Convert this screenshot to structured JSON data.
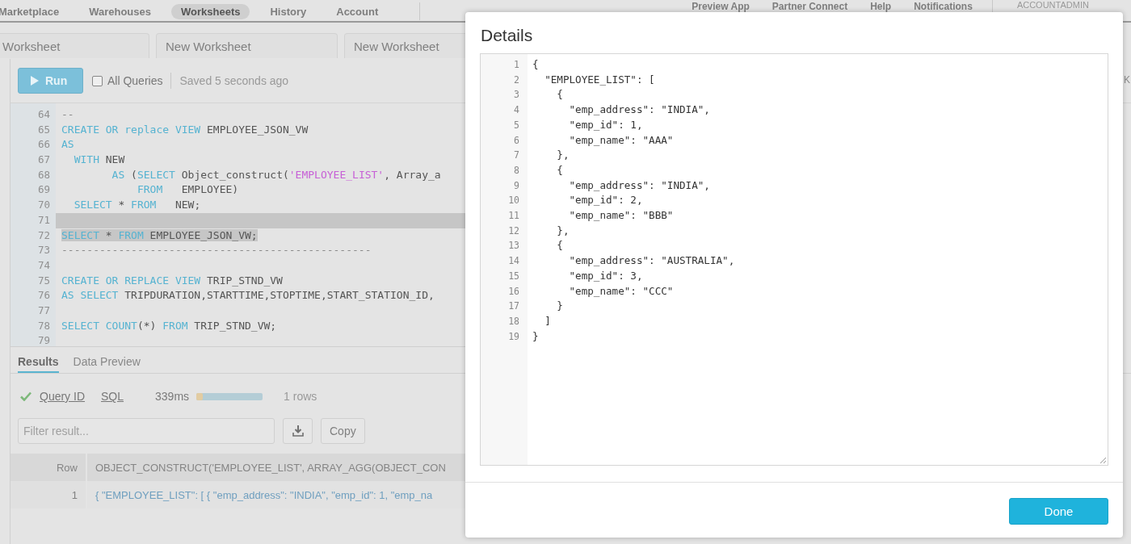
{
  "top_nav": {
    "items": [
      {
        "label": "Marketplace",
        "selected": false
      },
      {
        "label": "Warehouses",
        "selected": false
      },
      {
        "label": "Worksheets",
        "selected": true
      },
      {
        "label": "History",
        "selected": false
      },
      {
        "label": "Account",
        "selected": false
      }
    ],
    "right_items": [
      "Preview App",
      "Partner Connect",
      "Help",
      "Notifications"
    ],
    "account": "ACCOUNTADMIN"
  },
  "worksheet_tabs": [
    {
      "label": "Worksheet"
    },
    {
      "label": "New Worksheet"
    },
    {
      "label": "New Worksheet"
    }
  ],
  "toolbar": {
    "run_button": "Run",
    "all_queries": {
      "label": "All Queries",
      "checked": false
    },
    "saved_status": "Saved 5 seconds ago",
    "cut_text": "K"
  },
  "editor": {
    "lines": [
      {
        "number": "64",
        "selected": false,
        "tokens": [
          {
            "kind": "comment",
            "text": "--"
          }
        ]
      },
      {
        "number": "65",
        "selected": false,
        "tokens": [
          {
            "kind": "keyword",
            "text": "CREATE OR replace VIEW"
          },
          {
            "kind": "plain",
            "text": " EMPLOYEE_JSON_VW"
          }
        ]
      },
      {
        "number": "66",
        "selected": false,
        "tokens": [
          {
            "kind": "keyword",
            "text": "AS"
          }
        ]
      },
      {
        "number": "67",
        "selected": false,
        "tokens": [
          {
            "kind": "keyword",
            "text": "  WITH"
          },
          {
            "kind": "plain",
            "text": " NEW"
          }
        ]
      },
      {
        "number": "68",
        "selected": false,
        "tokens": [
          {
            "kind": "keyword",
            "text": "        AS"
          },
          {
            "kind": "plain",
            "text": " ("
          },
          {
            "kind": "keyword",
            "text": "SELECT"
          },
          {
            "kind": "plain",
            "text": " Object_construct("
          },
          {
            "kind": "string",
            "text": "'EMPLOYEE_LIST'"
          },
          {
            "kind": "plain",
            "text": ", Array_a"
          }
        ]
      },
      {
        "number": "69",
        "selected": false,
        "tokens": [
          {
            "kind": "keyword",
            "text": "            FROM"
          },
          {
            "kind": "plain",
            "text": "   EMPLOYEE)"
          }
        ]
      },
      {
        "number": "70",
        "selected": false,
        "tokens": [
          {
            "kind": "keyword",
            "text": "  SELECT"
          },
          {
            "kind": "plain",
            "text": " * "
          },
          {
            "kind": "keyword",
            "text": "FROM"
          },
          {
            "kind": "plain",
            "text": "   NEW;"
          }
        ]
      },
      {
        "number": "71",
        "selected": true
      },
      {
        "number": "72",
        "selected": true,
        "tokens": [
          {
            "kind": "keyword",
            "text": "SELECT"
          },
          {
            "kind": "plain",
            "text": " * "
          },
          {
            "kind": "keyword",
            "text": "FROM"
          },
          {
            "kind": "plain",
            "text": " EMPLOYEE_JSON_VW;"
          }
        ]
      },
      {
        "number": "73",
        "selected": false,
        "tokens": [
          {
            "kind": "comment",
            "text": "-------------------------------------------------"
          }
        ]
      },
      {
        "number": "74",
        "selected": false
      },
      {
        "number": "75",
        "selected": false,
        "tokens": [
          {
            "kind": "keyword",
            "text": "CREATE OR REPLACE VIEW"
          },
          {
            "kind": "plain",
            "text": " TRIP_STND_VW"
          }
        ]
      },
      {
        "number": "76",
        "selected": false,
        "tokens": [
          {
            "kind": "keyword",
            "text": "AS SELECT"
          },
          {
            "kind": "plain",
            "text": " TRIPDURATION,STARTTIME,STOPTIME,START_STATION_ID,"
          }
        ]
      },
      {
        "number": "77",
        "selected": false
      },
      {
        "number": "78",
        "selected": false,
        "tokens": [
          {
            "kind": "keyword",
            "text": "SELECT COUNT"
          },
          {
            "kind": "plain",
            "text": "(*) "
          },
          {
            "kind": "keyword",
            "text": "FROM"
          },
          {
            "kind": "plain",
            "text": " TRIP_STND_VW;"
          }
        ]
      },
      {
        "number": "79",
        "selected": false
      }
    ]
  },
  "results": {
    "tabs": [
      {
        "label": "Results",
        "selected": true
      },
      {
        "label": "Data Preview",
        "selected": false
      }
    ],
    "query_id_link": "Query ID",
    "sql_link": "SQL",
    "duration": "339ms",
    "rows_count": "1 rows",
    "filter": {
      "placeholder": "Filter result..."
    },
    "copy_button": "Copy",
    "table": {
      "columns": [
        "Row",
        "OBJECT_CONSTRUCT('EMPLOYEE_LIST', ARRAY_AGG(OBJECT_CON"
      ],
      "rows": [
        [
          "1",
          "{ \"EMPLOYEE_LIST\": [ { \"emp_address\": \"INDIA\", \"emp_id\": 1, \"emp_na"
        ]
      ]
    }
  },
  "details_dialog": {
    "title": "Details",
    "lines": [
      {
        "number": "1",
        "text": "{"
      },
      {
        "number": "2",
        "text": "  \"EMPLOYEE_LIST\": ["
      },
      {
        "number": "3",
        "text": "    {"
      },
      {
        "number": "4",
        "text": "      \"emp_address\": \"INDIA\","
      },
      {
        "number": "5",
        "text": "      \"emp_id\": 1,"
      },
      {
        "number": "6",
        "text": "      \"emp_name\": \"AAA\""
      },
      {
        "number": "7",
        "text": "    },"
      },
      {
        "number": "8",
        "text": "    {"
      },
      {
        "number": "9",
        "text": "      \"emp_address\": \"INDIA\","
      },
      {
        "number": "10",
        "text": "      \"emp_id\": 2,"
      },
      {
        "number": "11",
        "text": "      \"emp_name\": \"BBB\""
      },
      {
        "number": "12",
        "text": "    },"
      },
      {
        "number": "13",
        "text": "    {"
      },
      {
        "number": "14",
        "text": "      \"emp_address\": \"AUSTRALIA\","
      },
      {
        "number": "15",
        "text": "      \"emp_id\": 3,"
      },
      {
        "number": "16",
        "text": "      \"emp_name\": \"CCC\""
      },
      {
        "number": "17",
        "text": "    }"
      },
      {
        "number": "18",
        "text": "  ]"
      },
      {
        "number": "19",
        "text": "}"
      }
    ],
    "done_button": "Done"
  }
}
